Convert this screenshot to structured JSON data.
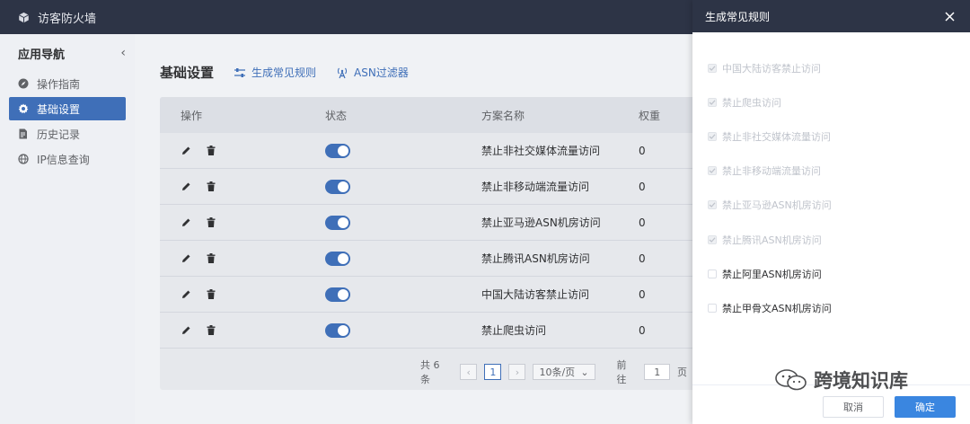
{
  "topbar": {
    "app_title": "访客防火墙",
    "logo_icon": "cube-icon"
  },
  "sidebar": {
    "heading": "应用导航",
    "collapse_glyph": "‹",
    "items": [
      {
        "label": "操作指南",
        "icon": "compass-icon",
        "active": false
      },
      {
        "label": "基础设置",
        "icon": "gear-icon",
        "active": true
      },
      {
        "label": "历史记录",
        "icon": "document-icon",
        "active": false
      },
      {
        "label": "IP信息查询",
        "icon": "globe-icon",
        "active": false
      }
    ]
  },
  "main": {
    "title": "基础设置",
    "links": [
      {
        "label": "生成常见规则",
        "icon": "sliders-icon"
      },
      {
        "label": "ASN过滤器",
        "icon": "antenna-icon"
      }
    ],
    "table": {
      "columns": [
        "操作",
        "状态",
        "方案名称",
        "权重"
      ],
      "rows": [
        {
          "name": "禁止非社交媒体流量访问",
          "weight": "0",
          "enabled": true
        },
        {
          "name": "禁止非移动端流量访问",
          "weight": "0",
          "enabled": true
        },
        {
          "name": "禁止亚马逊ASN机房访问",
          "weight": "0",
          "enabled": true
        },
        {
          "name": "禁止腾讯ASN机房访问",
          "weight": "0",
          "enabled": true
        },
        {
          "name": "中国大陆访客禁止访问",
          "weight": "0",
          "enabled": true
        },
        {
          "name": "禁止爬虫访问",
          "weight": "0",
          "enabled": true
        }
      ]
    },
    "pagination": {
      "total_text": "共 6 条",
      "prev_glyph": "‹",
      "current_page": "1",
      "next_glyph": "›",
      "page_size": "10条/页",
      "size_caret": "⌄",
      "goto_label": "前往",
      "goto_value": "1",
      "page_suffix": "页"
    }
  },
  "panel": {
    "title": "生成常见规则",
    "options": [
      {
        "label": "中国大陆访客禁止访问",
        "checked": true,
        "disabled": true
      },
      {
        "label": "禁止爬虫访问",
        "checked": true,
        "disabled": true
      },
      {
        "label": "禁止非社交媒体流量访问",
        "checked": true,
        "disabled": true
      },
      {
        "label": "禁止非移动端流量访问",
        "checked": true,
        "disabled": true
      },
      {
        "label": "禁止亚马逊ASN机房访问",
        "checked": true,
        "disabled": true
      },
      {
        "label": "禁止腾讯ASN机房访问",
        "checked": true,
        "disabled": true
      },
      {
        "label": "禁止阿里ASN机房访问",
        "checked": false,
        "disabled": false
      },
      {
        "label": "禁止甲骨文ASN机房访问",
        "checked": false,
        "disabled": false
      }
    ],
    "cancel_label": "取消",
    "confirm_label": "确定"
  },
  "watermark": {
    "text": "跨境知识库"
  },
  "colors": {
    "accent": "#3f6fb8",
    "topbar": "#2d3446",
    "primary_button": "#3a86e0"
  }
}
